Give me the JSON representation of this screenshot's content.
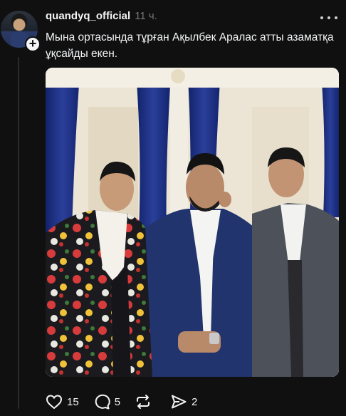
{
  "post": {
    "username": "quandyq_official",
    "timestamp": "11 ч.",
    "caption": "Мына ортасында тұрған Ақылбек Аралас атты азаматқа ұқсайды екен.",
    "follow_badge": "+"
  },
  "actions": {
    "likes": "15",
    "replies": "5",
    "reposts": "",
    "shares": "2"
  },
  "colors": {
    "background": "#101010",
    "text": "#f3f5f7",
    "muted": "#777777",
    "thread_line": "#2a2a2a"
  },
  "icons": [
    "heart-icon",
    "comment-icon",
    "repost-icon",
    "share-icon",
    "more-icon",
    "plus-icon"
  ]
}
